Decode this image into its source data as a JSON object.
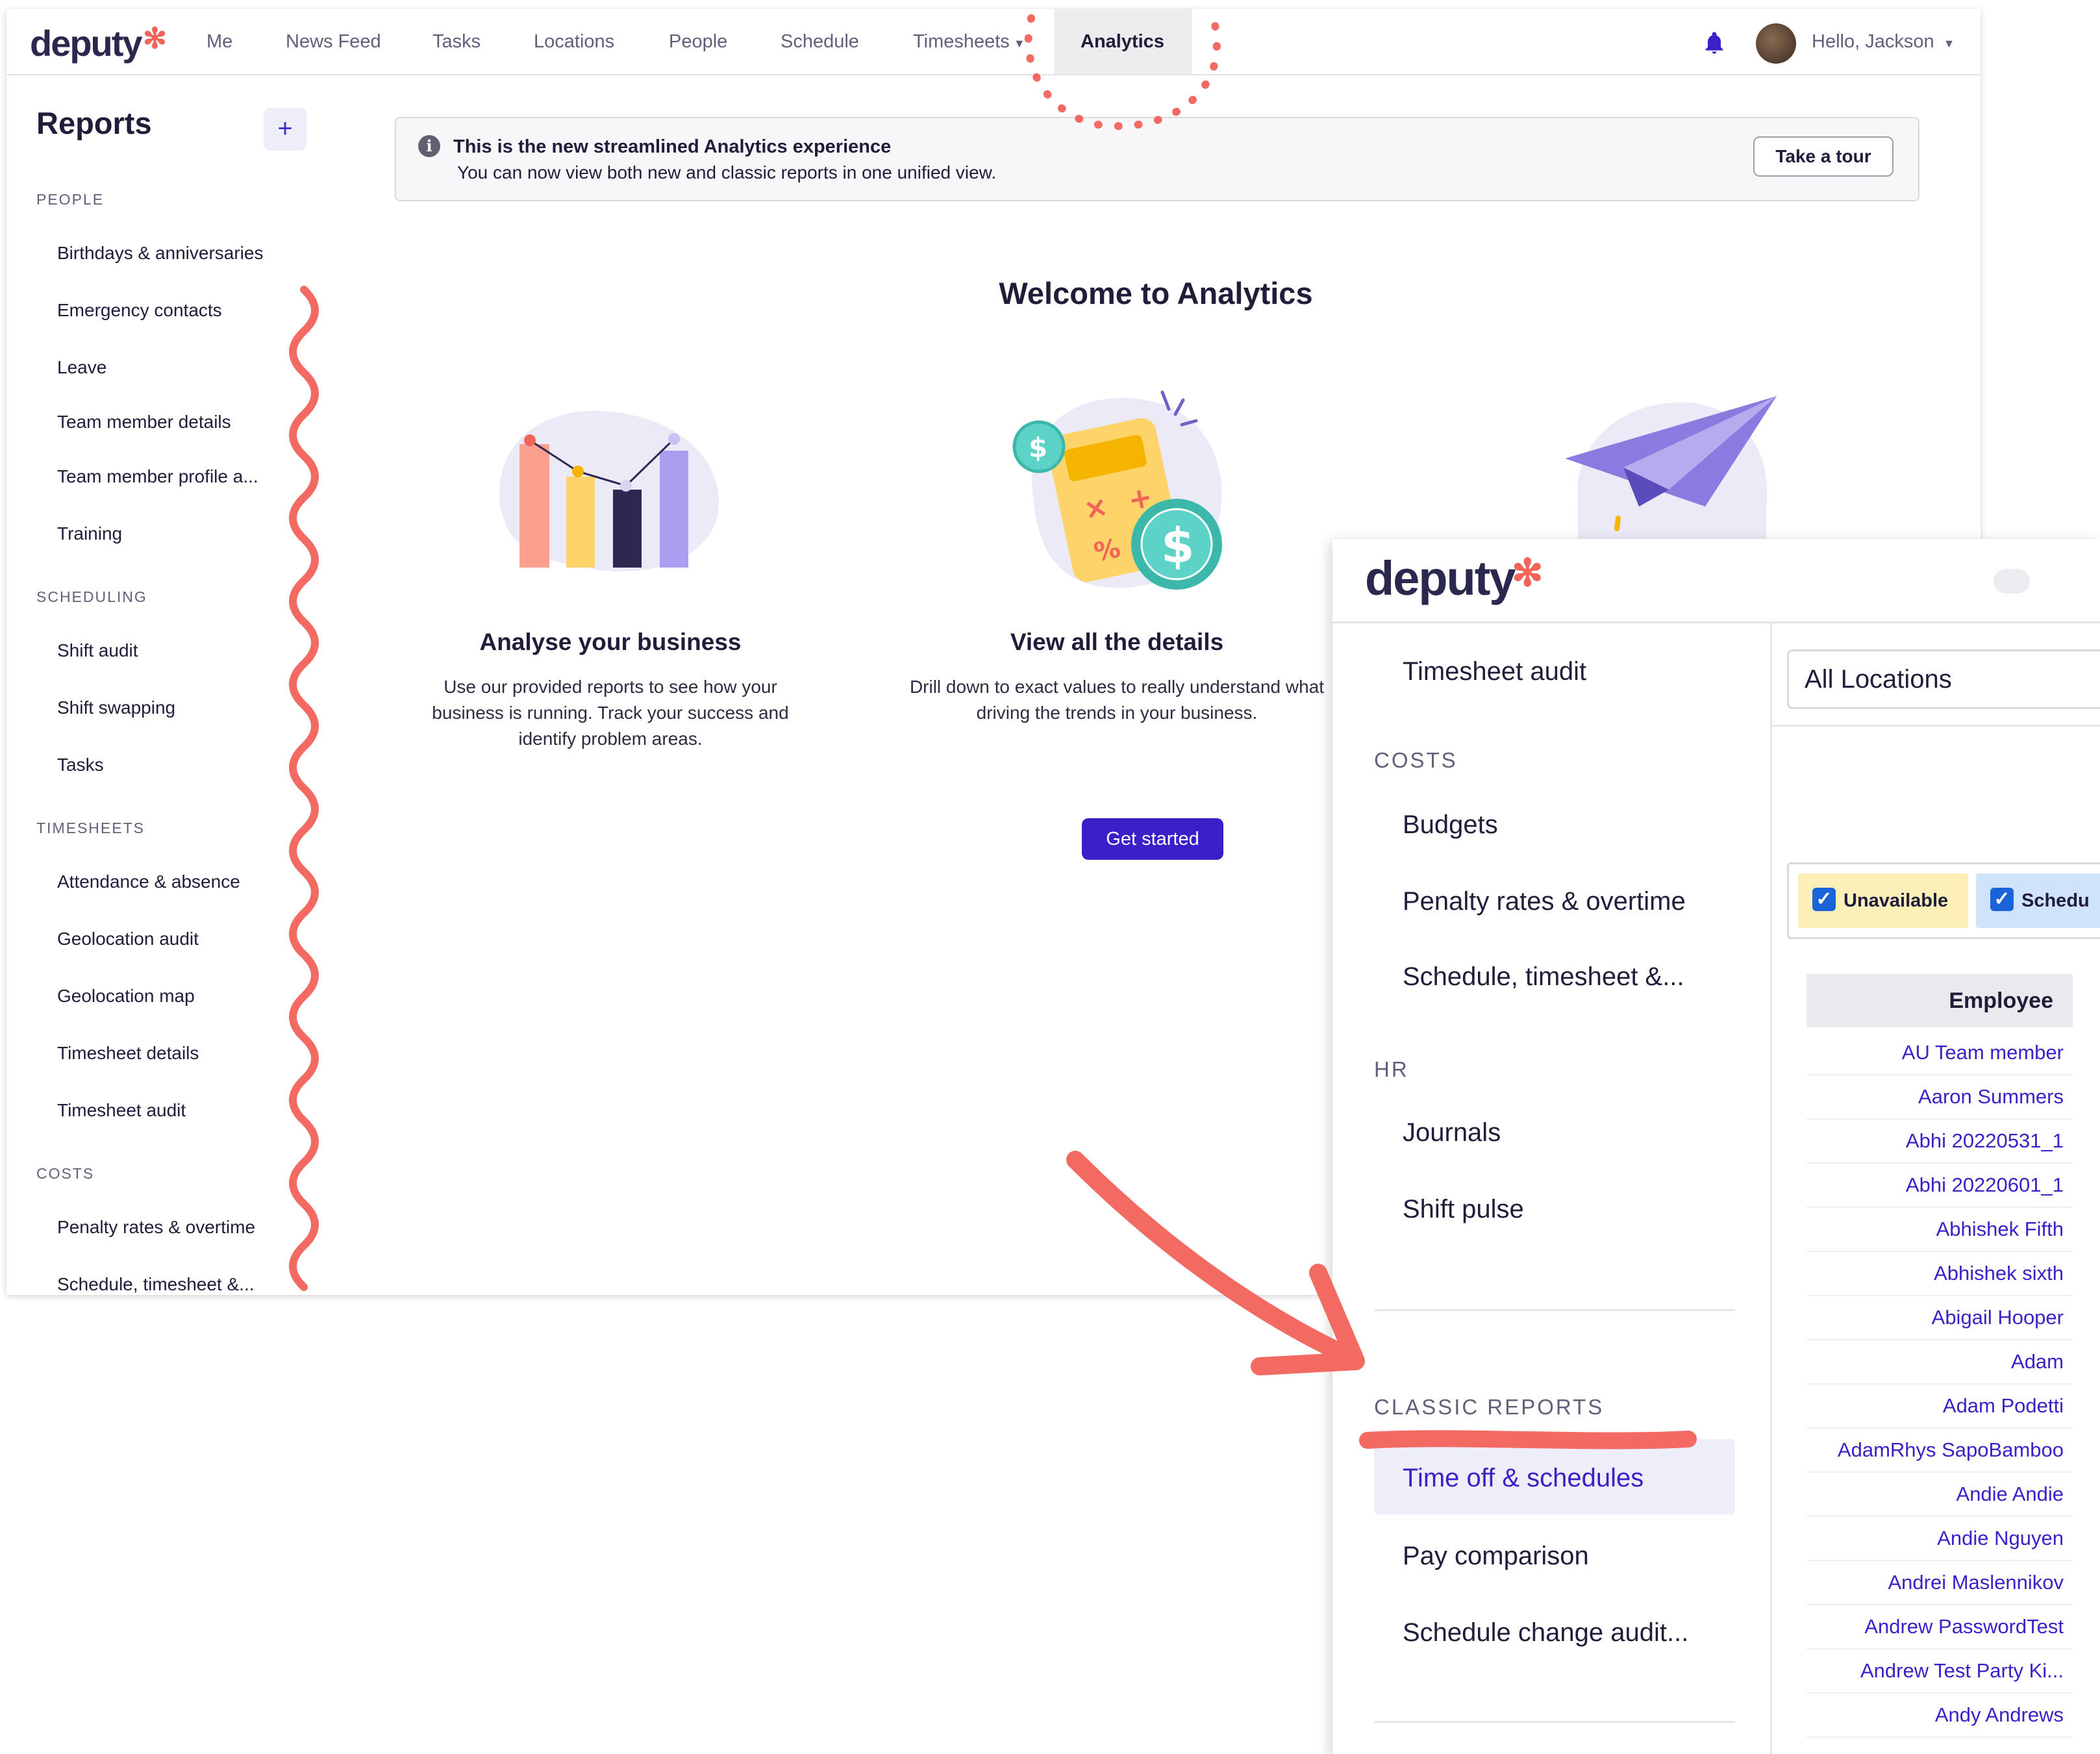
{
  "brand": {
    "logo_text": "deputy",
    "accent": "#f0645a",
    "primary": "#3b1fc8"
  },
  "topnav": {
    "items": [
      "Me",
      "News Feed",
      "Tasks",
      "Locations",
      "People",
      "Schedule",
      "Timesheets",
      "Analytics"
    ],
    "active": "Analytics",
    "greeting": "Hello, Jackson"
  },
  "sidebar": {
    "title": "Reports",
    "add_label": "+",
    "sections": [
      {
        "heading": "PEOPLE",
        "items": [
          "Birthdays & anniversaries",
          "Emergency contacts",
          "Leave",
          "Team member details",
          "Team member profile a...",
          "Training"
        ]
      },
      {
        "heading": "SCHEDULING",
        "items": [
          "Shift audit",
          "Shift swapping",
          "Tasks"
        ]
      },
      {
        "heading": "TIMESHEETS",
        "items": [
          "Attendance & absence",
          "Geolocation audit",
          "Geolocation map",
          "Timesheet details",
          "Timesheet audit"
        ]
      },
      {
        "heading": "COSTS",
        "items": [
          "Penalty rates & overtime",
          "Schedule, timesheet &..."
        ]
      }
    ]
  },
  "banner": {
    "title": "This is the new streamlined Analytics experience",
    "text": "You can now view both new and classic reports in one unified view.",
    "button": "Take a tour",
    "icon": "info-icon"
  },
  "welcome": {
    "title": "Welcome to Analytics",
    "features": [
      {
        "title": "Analyse your business",
        "lines": [
          "Use our provided reports to see how your",
          "business is running. Track your success and",
          "identify problem areas."
        ]
      },
      {
        "title": "View all the details",
        "lines": [
          "Drill down to exact values to really understand what",
          "driving the trends in your business."
        ]
      }
    ],
    "cta": "Get started"
  },
  "inset": {
    "logo_text": "deputy",
    "items_top": [
      "Timesheet audit"
    ],
    "costs_heading": "COSTS",
    "costs_items": [
      "Budgets",
      "Penalty rates & overtime",
      "Schedule, timesheet &..."
    ],
    "hr_heading": "HR",
    "hr_items": [
      "Journals",
      "Shift pulse"
    ],
    "classic_heading": "CLASSIC REPORTS",
    "classic_items": [
      "Time off & schedules",
      "Pay comparison",
      "Schedule change audit..."
    ],
    "location_select": "All Locations",
    "filters": [
      "Unavailable",
      "Schedu"
    ],
    "table_header": "Employee",
    "employees": [
      "AU Team member",
      "Aaron Summers",
      "Abhi 20220531_1",
      "Abhi 20220601_1",
      "Abhishek Fifth",
      "Abhishek sixth",
      "Abigail Hooper",
      "Adam",
      "Adam Podetti",
      "AdamRhys SapoBamboo",
      "Andie Andie",
      "Andie Nguyen",
      "Andrei Maslennikov",
      "Andrew PasswordTest",
      "Andrew Test Party Ki...",
      "Andy Andrews"
    ]
  }
}
